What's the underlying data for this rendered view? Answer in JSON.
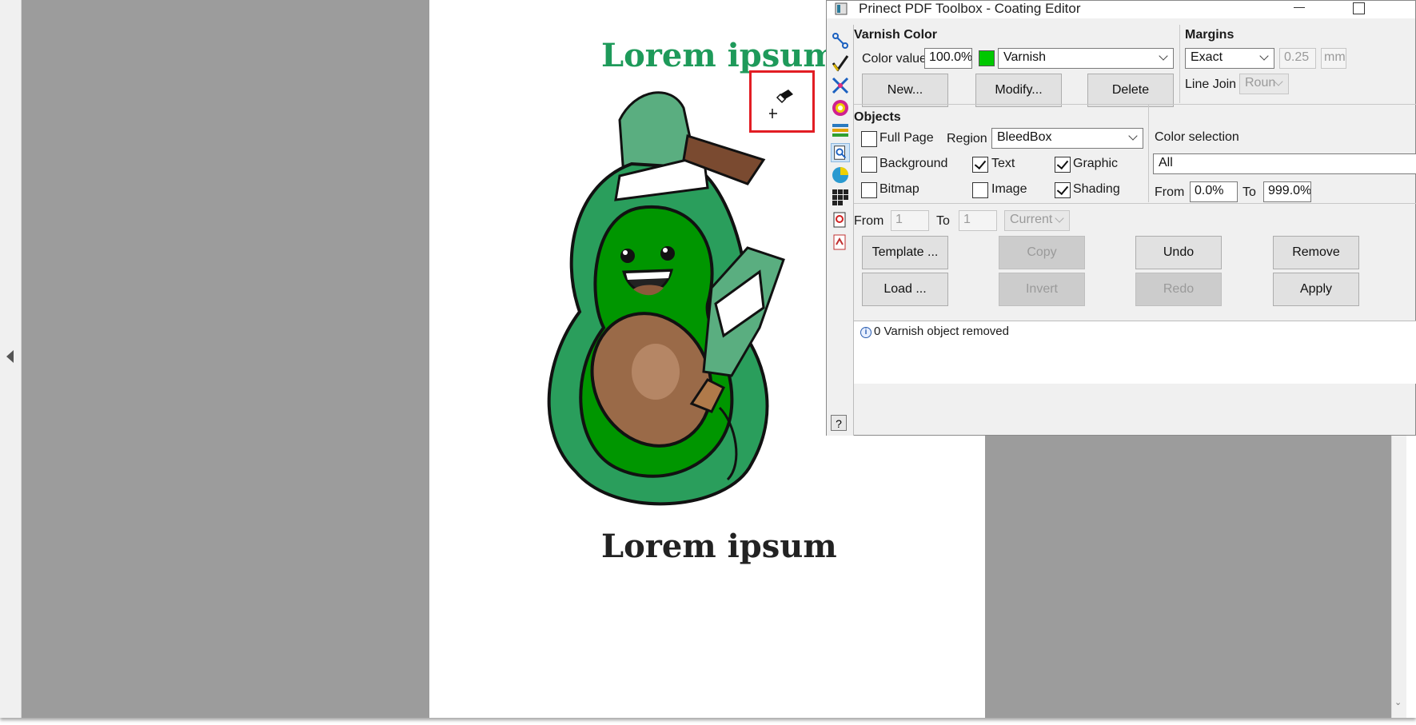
{
  "dialog": {
    "title": "Prinect PDF Toolbox - Coating Editor",
    "varnish_color": {
      "heading": "Varnish Color",
      "color_value_label": "Color value",
      "color_value": "100.0%",
      "swatch_color": "#00c800",
      "color_name": "Varnish",
      "new_label": "New...",
      "modify_label": "Modify...",
      "delete_label": "Delete"
    },
    "margins": {
      "heading": "Margins",
      "mode": "Exact",
      "value": "0.25",
      "unit": "mm",
      "line_join_label": "Line Join",
      "line_join_value": "Roun"
    },
    "objects": {
      "heading": "Objects",
      "full_page": "Full Page",
      "region_label": "Region",
      "region_value": "BleedBox",
      "background": "Background",
      "text": "Text",
      "graphic": "Graphic",
      "bitmap": "Bitmap",
      "image": "Image",
      "shading": "Shading"
    },
    "color_selection": {
      "heading": "Color selection",
      "value": "All",
      "from_label": "From",
      "from_value": "0.0%",
      "to_label": "To",
      "to_value": "999.0%"
    },
    "pages": {
      "from_label": "From",
      "from_value": "1",
      "to_label": "To",
      "to_value": "1",
      "scope": "Current"
    },
    "actions": {
      "template": "Template ...",
      "copy": "Copy",
      "undo": "Undo",
      "remove": "Remove",
      "load": "Load ...",
      "invert": "Invert",
      "redo": "Redo",
      "apply": "Apply"
    },
    "status_message": "0 Varnish object removed",
    "help": "?"
  },
  "document": {
    "top_text": "Lorem ipsum",
    "bottom_text": "Lorem ipsum",
    "top_text_color": "#1e9a5a"
  }
}
